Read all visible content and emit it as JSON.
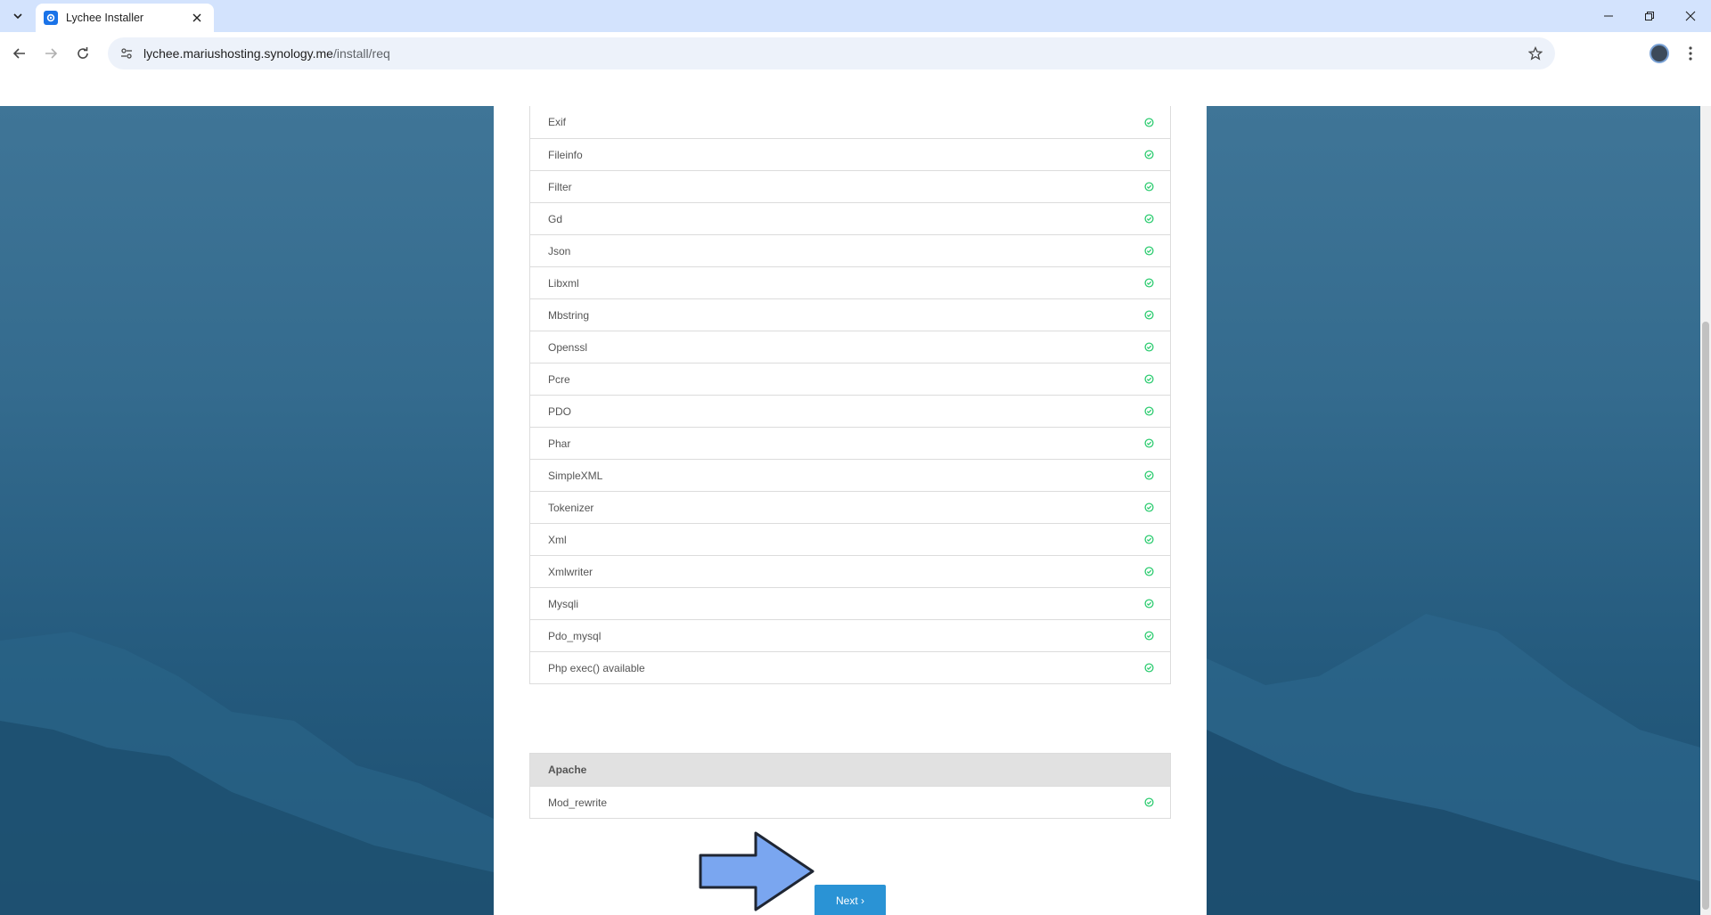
{
  "browser": {
    "tab_title": "Lychee Installer",
    "url_host": "lychee.mariushosting.synology.me",
    "url_path": "/install/req"
  },
  "requirements": [
    {
      "name": "Exif",
      "status": "ok"
    },
    {
      "name": "Fileinfo",
      "status": "ok"
    },
    {
      "name": "Filter",
      "status": "ok"
    },
    {
      "name": "Gd",
      "status": "ok"
    },
    {
      "name": "Json",
      "status": "ok"
    },
    {
      "name": "Libxml",
      "status": "ok"
    },
    {
      "name": "Mbstring",
      "status": "ok"
    },
    {
      "name": "Openssl",
      "status": "ok"
    },
    {
      "name": "Pcre",
      "status": "ok"
    },
    {
      "name": "PDO",
      "status": "ok"
    },
    {
      "name": "Phar",
      "status": "ok"
    },
    {
      "name": "SimpleXML",
      "status": "ok"
    },
    {
      "name": "Tokenizer",
      "status": "ok"
    },
    {
      "name": "Xml",
      "status": "ok"
    },
    {
      "name": "Xmlwriter",
      "status": "ok"
    },
    {
      "name": "Mysqli",
      "status": "ok"
    },
    {
      "name": "Pdo_mysql",
      "status": "ok"
    },
    {
      "name": "Php exec() available",
      "status": "ok"
    }
  ],
  "apache": {
    "header": "Apache",
    "items": [
      {
        "name": "Mod_rewrite",
        "status": "ok"
      }
    ]
  },
  "next_button": {
    "label": "Next ›"
  },
  "colors": {
    "ok": "#2ecc71",
    "button": "#2a93d5",
    "annotation_arrow": "#7aa6f0"
  },
  "icons": {
    "ok": "check-circle-icon",
    "annotation": "arrow-right-icon"
  }
}
